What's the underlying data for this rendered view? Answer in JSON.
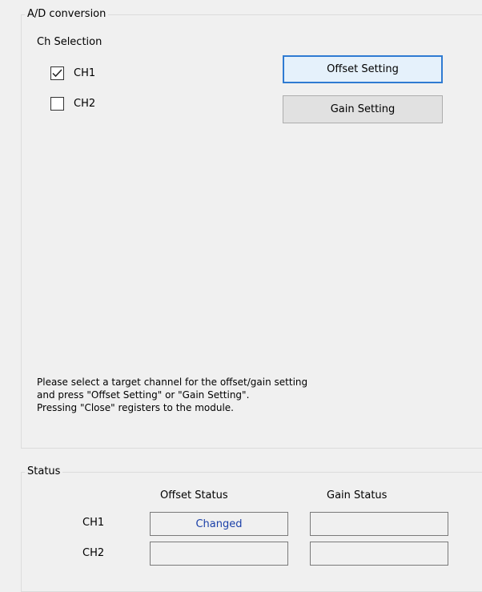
{
  "ad_group": {
    "title": "A/D conversion",
    "ch_selection_label": "Ch Selection",
    "channels": [
      {
        "label": "CH1",
        "checked": true
      },
      {
        "label": "CH2",
        "checked": false
      }
    ],
    "offset_button": "Offset Setting",
    "gain_button": "Gain Setting",
    "help_lines": [
      "Please select a target channel for the offset/gain setting",
      "and press \"Offset Setting\" or \"Gain Setting\".",
      "Pressing \"Close\" registers to the module."
    ]
  },
  "status_group": {
    "title": "Status",
    "offset_header": "Offset Status",
    "gain_header": "Gain Status",
    "rows": [
      {
        "label": "CH1",
        "offset": "Changed",
        "gain": ""
      },
      {
        "label": "CH2",
        "offset": "",
        "gain": ""
      }
    ]
  },
  "colors": {
    "background": "#f0f0f0",
    "default_button_border": "#2f7bd2",
    "changed_text": "#1a3fa8"
  }
}
